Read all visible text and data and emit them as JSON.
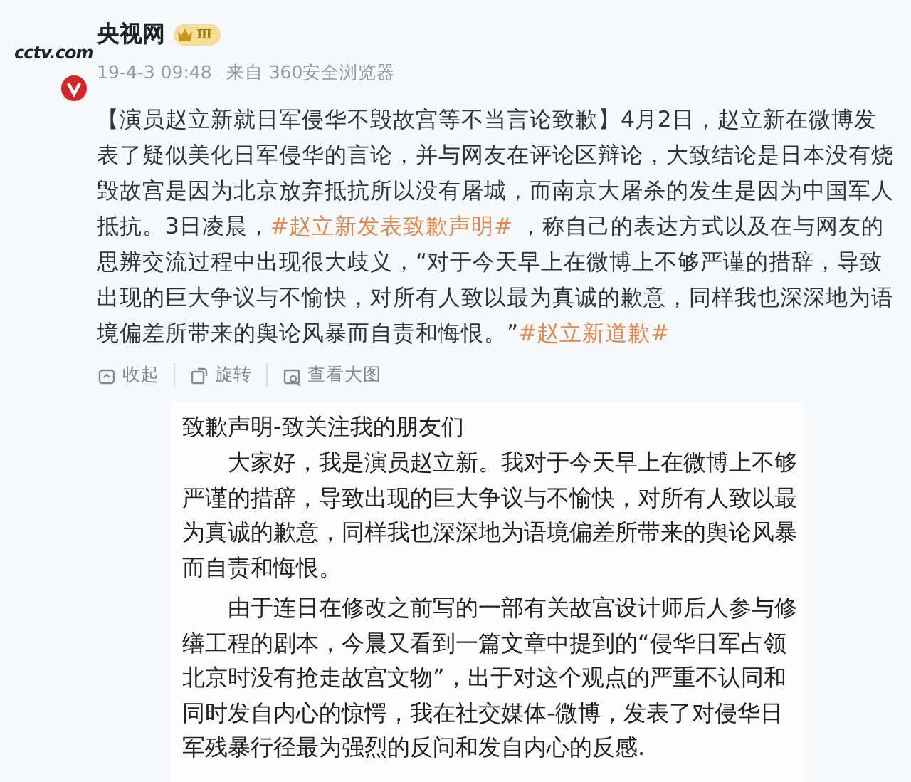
{
  "account": {
    "logo": "cctv.com",
    "name": "央视网",
    "level_badge": "Ⅲ",
    "time": "19-4-3 09:48",
    "source": "来自 360安全浏览器"
  },
  "post": {
    "segments": [
      {
        "kind": "text",
        "text": "【演员赵立新就日军侵华不毁故宫等不当言论致歉】4月2日，赵立新在微博发表了疑似美化日军侵华的言论，并与网友在评论区辩论，大致结论是日本没有烧毁故宫是因为北京放弃抵抗所以没有屠城，而南京大屠杀的发生是因为中国军人抵抗。3日凌晨，"
      },
      {
        "kind": "hashtag",
        "text": "#赵立新发表致歉声明#"
      },
      {
        "kind": "text",
        "text": " ，称自己的表达方式以及在与网友的思辨交流过程中出现很大歧义，“对于今天早上在微博上不够严谨的措辞，导致出现的巨大争议与不愉快，对所有人致以最为真诚的歉意，同样我也深深地为语境偏差所带来的舆论风暴而自责和悔恨。”"
      },
      {
        "kind": "hashtag",
        "text": "#赵立新道歉#"
      }
    ]
  },
  "actions": [
    {
      "kind": "collapse",
      "label": "收起"
    },
    {
      "kind": "rotate",
      "label": "旋转"
    },
    {
      "kind": "enlarge",
      "label": "查看大图"
    }
  ],
  "image": {
    "title": "致歉声明-致关注我的朋友们",
    "paragraphs": [
      "大家好，我是演员赵立新。我对于今天早上在微博上不够严谨的措辞，导致出现的巨大争议与不愉快，对所有人致以最为真诚的歉意，同样我也深深地为语境偏差所带来的舆论风暴而自责和悔恨。",
      "由于连日在修改之前写的一部有关故宫设计师后人参与修缮工程的剧本，今晨又看到一篇文章中提到的“侵华日军占领北京时没有抢走故宫文物”，出于对这个观点的严重不认同和同时发自内心的惊愕，我在社交媒体-微博，发表了对侵华日军残暴行径最为强烈的反问和发自内心的反感."
    ]
  }
}
